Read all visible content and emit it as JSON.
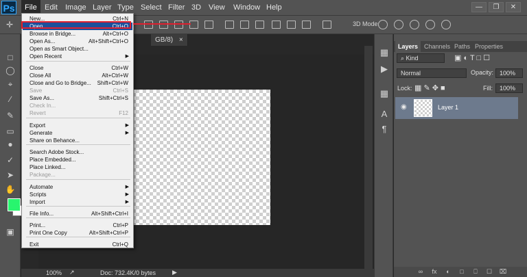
{
  "app": {
    "logo": "Ps"
  },
  "menubar": {
    "items": [
      "File",
      "Edit",
      "Image",
      "Layer",
      "Type",
      "Select",
      "Filter",
      "3D",
      "View",
      "Window",
      "Help"
    ],
    "window_controls": [
      "—",
      "❐",
      "✕"
    ]
  },
  "optionsbar": {
    "mode_3d": "3D Mode:"
  },
  "document": {
    "tab": "GB/8)",
    "tab_close": "×"
  },
  "status": {
    "zoom": "100%",
    "doc": "Doc: 732.4K/0 bytes"
  },
  "colors": {
    "foreground": "#28f56e",
    "background": "#ffffff",
    "highlight": "#1c4f9b",
    "annotation": "#e0202e"
  },
  "file_menu": {
    "items": [
      {
        "label": "New...",
        "shortcut": "Ctrl+N"
      },
      {
        "label": "Open...",
        "shortcut": "Ctrl+O",
        "highlight": true
      },
      {
        "label": "Browse in Bridge...",
        "shortcut": "Alt+Ctrl+O"
      },
      {
        "label": "Open As...",
        "shortcut": "Alt+Shift+Ctrl+O"
      },
      {
        "label": "Open as Smart Object..."
      },
      {
        "label": "Open Recent",
        "submenu": true
      },
      {
        "label": "Close",
        "shortcut": "Ctrl+W"
      },
      {
        "label": "Close All",
        "shortcut": "Alt+Ctrl+W"
      },
      {
        "label": "Close and Go to Bridge...",
        "shortcut": "Shift+Ctrl+W"
      },
      {
        "label": "Save",
        "shortcut": "Ctrl+S",
        "disabled": true
      },
      {
        "label": "Save As...",
        "shortcut": "Shift+Ctrl+S"
      },
      {
        "label": "Check In...",
        "disabled": true
      },
      {
        "label": "Revert",
        "shortcut": "F12",
        "disabled": true
      },
      {
        "label": "Export",
        "submenu": true
      },
      {
        "label": "Generate",
        "submenu": true
      },
      {
        "label": "Share on Behance..."
      },
      {
        "label": "Search Adobe Stock..."
      },
      {
        "label": "Place Embedded..."
      },
      {
        "label": "Place Linked..."
      },
      {
        "label": "Package...",
        "disabled": true
      },
      {
        "label": "Automate",
        "submenu": true
      },
      {
        "label": "Scripts",
        "submenu": true
      },
      {
        "label": "Import",
        "submenu": true
      },
      {
        "label": "File Info...",
        "shortcut": "Alt+Shift+Ctrl+I"
      },
      {
        "label": "Print...",
        "shortcut": "Ctrl+P"
      },
      {
        "label": "Print One Copy",
        "shortcut": "Alt+Shift+Ctrl+P"
      },
      {
        "label": "Exit",
        "shortcut": "Ctrl+Q"
      }
    ]
  },
  "layers_panel": {
    "tabs": [
      "Layers",
      "Channels",
      "Paths",
      "Properties"
    ],
    "filter": "⌕ Kind",
    "blend_mode": "Normal",
    "opacity_label": "Opacity:",
    "opacity_value": "100%",
    "lock_label": "Lock:",
    "fill_label": "Fill:",
    "fill_value": "100%",
    "layers": [
      {
        "name": "Layer 1"
      }
    ],
    "bottom_icons": [
      "∞",
      "fx",
      "◐",
      "□",
      "⎕",
      "☐",
      "⌧"
    ]
  }
}
